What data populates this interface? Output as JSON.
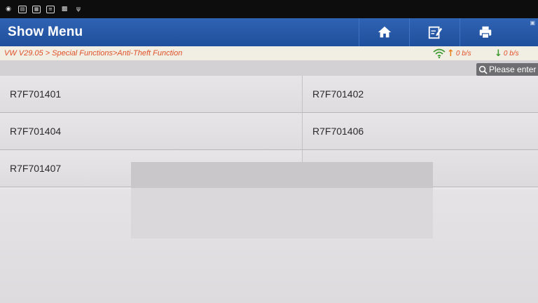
{
  "status_bar": {
    "icons": [
      "eye-icon",
      "gallery-icon",
      "tablet-icon",
      "message-icon",
      "image-icon",
      "usb-icon"
    ]
  },
  "header": {
    "title": "Show Menu",
    "buttons": [
      "home-icon",
      "edit-icon",
      "print-icon"
    ]
  },
  "breadcrumb": {
    "text": "VW V29.05 > Special Functions>Anti-Theft Function"
  },
  "network": {
    "upload": "0 b/s",
    "download": "0 b/s"
  },
  "search": {
    "placeholder": "Please enter"
  },
  "menu": {
    "rows": [
      [
        "R7F701401",
        "R7F701402"
      ],
      [
        "R7F701404",
        "R7F701406"
      ],
      [
        "R7F701407",
        ""
      ]
    ]
  },
  "colors": {
    "title_bar": "#1f4f9c",
    "breadcrumb_text": "#e0502a",
    "upload_arrow": "#e8811c",
    "download_arrow": "#3c9a2e"
  }
}
